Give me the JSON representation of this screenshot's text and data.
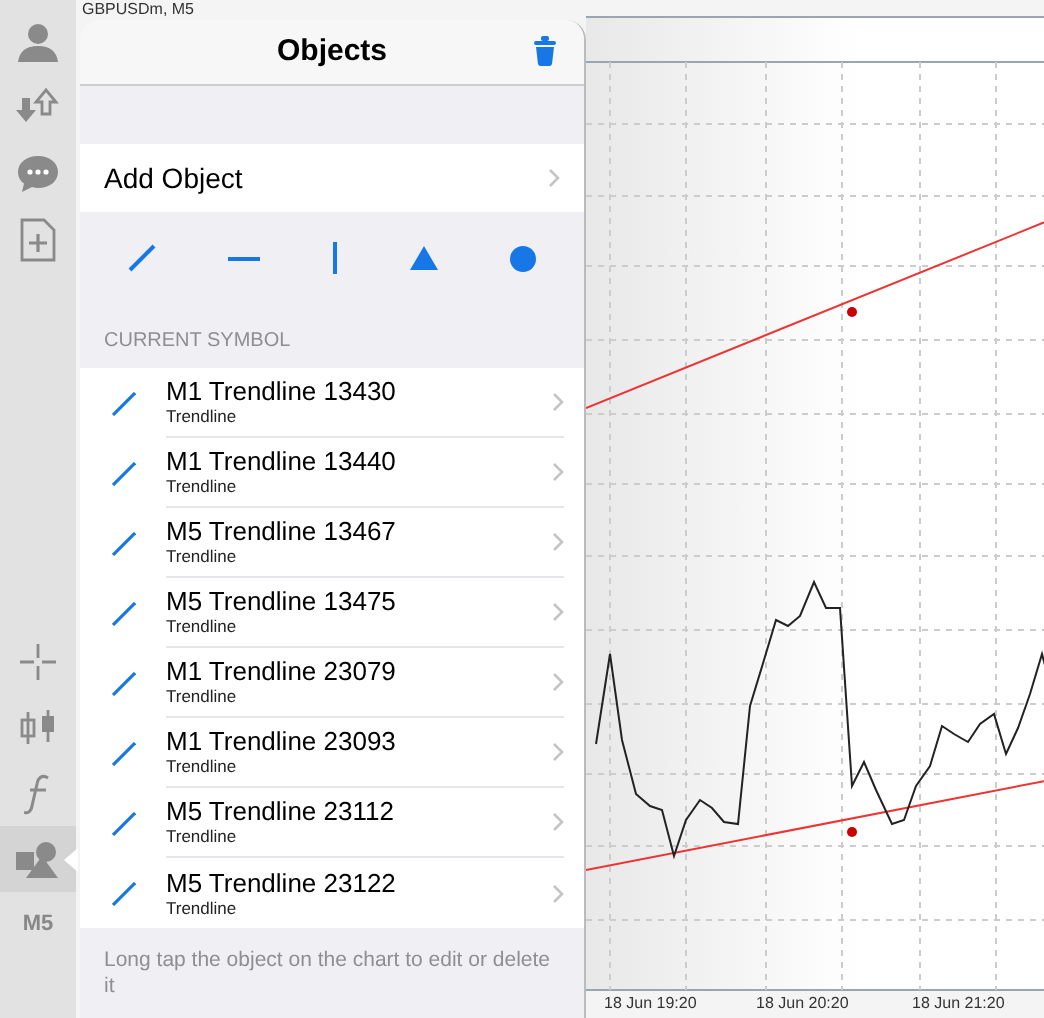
{
  "chart": {
    "symbol": "GBPUSDm, M5",
    "x_labels": [
      "18 Jun 19:20",
      "18 Jun 20:20",
      "18 Jun 21:20"
    ]
  },
  "sidebar": {
    "items": [
      {
        "selected": false
      },
      {
        "selected": false
      },
      {
        "selected": false
      },
      {
        "selected": false
      },
      {
        "selected": false
      },
      {
        "selected": false
      },
      {
        "selected": false
      },
      {
        "selected": true
      },
      {
        "label": "M5",
        "selected": false
      }
    ]
  },
  "popover": {
    "title": "Objects",
    "add_object": "Add Object",
    "section": "CURRENT SYMBOL",
    "objects": [
      {
        "title": "M1 Trendline 13430",
        "type": "Trendline"
      },
      {
        "title": "M1 Trendline 13440",
        "type": "Trendline"
      },
      {
        "title": "M5 Trendline 13467",
        "type": "Trendline"
      },
      {
        "title": "M5 Trendline 13475",
        "type": "Trendline"
      },
      {
        "title": "M1 Trendline 23079",
        "type": "Trendline"
      },
      {
        "title": "M1 Trendline 23093",
        "type": "Trendline"
      },
      {
        "title": "M5 Trendline 23112",
        "type": "Trendline"
      },
      {
        "title": "M5 Trendline 23122",
        "type": "Trendline"
      }
    ],
    "hint": "Long tap the object on the chart to edit or delete it"
  }
}
